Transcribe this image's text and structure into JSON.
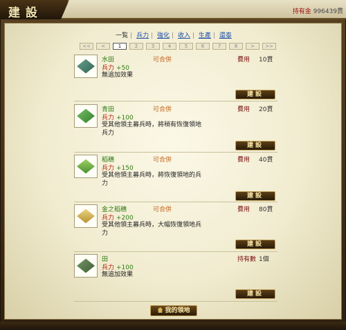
{
  "header": {
    "title": "建設",
    "gold_label": "持有金",
    "gold_value": "996439貫"
  },
  "tabs": [
    {
      "label": "一覧",
      "active": true
    },
    {
      "label": "兵力",
      "active": false
    },
    {
      "label": "強化",
      "active": false
    },
    {
      "label": "收入",
      "active": false
    },
    {
      "label": "生產",
      "active": false
    },
    {
      "label": "還泰",
      "active": false
    }
  ],
  "pager": {
    "first": "<<",
    "prev": "<",
    "pages": [
      "1",
      "2",
      "3",
      "4",
      "5",
      "6",
      "7",
      "8"
    ],
    "current": "1",
    "next": ">",
    "last": ">>"
  },
  "items": [
    {
      "name": "水田",
      "merge": "可合併",
      "cost_label": "費用",
      "cost_value": "10貫",
      "power_label": "兵力",
      "power_value": "+50",
      "desc": "無追加效果",
      "button": "建設",
      "icon": "paddy-field-icon",
      "color": "#3f7a6a"
    },
    {
      "name": "青田",
      "merge": "可合併",
      "cost_label": "費用",
      "cost_value": "20貫",
      "power_label": "兵力",
      "power_value": "+100",
      "desc": "受其他領主募兵時，將稍有恢復領地兵力",
      "button": "建設",
      "icon": "green-field-icon",
      "color": "#3f9a3a"
    },
    {
      "name": "稻穗",
      "merge": "可合併",
      "cost_label": "費用",
      "cost_value": "40貫",
      "power_label": "兵力",
      "power_value": "+150",
      "desc": "受其他領主募兵時，將恢復領地的兵力",
      "button": "建設",
      "icon": "rice-ear-icon",
      "color": "#6aa13a"
    },
    {
      "name": "金之稻穗",
      "merge": "可合併",
      "cost_label": "費用",
      "cost_value": "80貫",
      "power_label": "兵力",
      "power_value": "+200",
      "desc": "受其他領主募兵時，大幅恢復領地兵力",
      "button": "建設",
      "icon": "golden-rice-ear-icon",
      "color": "#c9a63a"
    },
    {
      "name": "田",
      "merge": "",
      "cost_label": "持有數",
      "cost_value": "1個",
      "power_label": "兵力",
      "power_value": "+100",
      "desc": "無追加效果",
      "button": "建設",
      "icon": "field-icon",
      "color": "#4e7a4a"
    }
  ],
  "footer": {
    "my_land": "我的領地"
  }
}
